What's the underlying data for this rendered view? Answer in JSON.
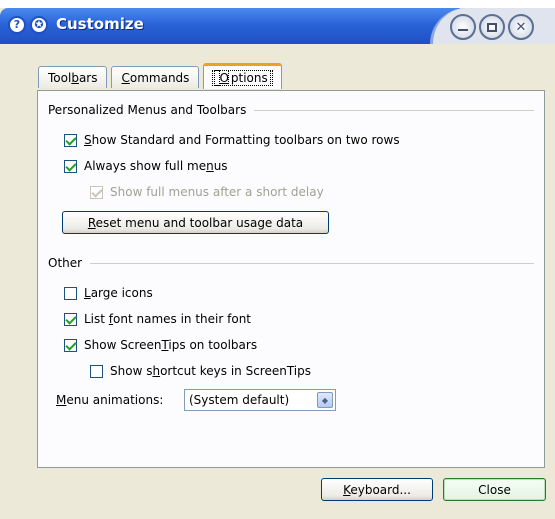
{
  "window": {
    "title": "Customize",
    "help_glyph": "?",
    "pin_glyph": "✪",
    "close_glyph": "✕"
  },
  "tabs": [
    {
      "label_pre": "Tool",
      "mnemonic": "b",
      "label_post": "ars",
      "active": false
    },
    {
      "label_pre": "",
      "mnemonic": "C",
      "label_post": "ommands",
      "active": false
    },
    {
      "label_pre": "",
      "mnemonic": "O",
      "label_post": "ptions",
      "active": true
    }
  ],
  "personalized": {
    "heading": "Personalized Menus and Toolbars",
    "options": [
      {
        "pre": "",
        "m": "S",
        "post": "how Standard and Formatting toolbars on two rows",
        "checked": true,
        "enabled": true
      },
      {
        "pre": "Always show full me",
        "m": "n",
        "post": "us",
        "checked": true,
        "enabled": true
      },
      {
        "pre": "Show full menus after a short delay",
        "m": "",
        "post": "",
        "checked": true,
        "enabled": false
      }
    ],
    "reset_button": {
      "pre": "",
      "m": "R",
      "post": "eset menu and toolbar usage data"
    }
  },
  "other": {
    "heading": "Other",
    "options": [
      {
        "pre": "",
        "m": "L",
        "post": "arge icons",
        "checked": false
      },
      {
        "pre": "List ",
        "m": "f",
        "post": "ont names in their font",
        "checked": true
      },
      {
        "pre": "Show Screen",
        "m": "T",
        "post": "ips on toolbars",
        "checked": true
      },
      {
        "pre": "Show s",
        "m": "h",
        "post": "ortcut keys in ScreenTips",
        "checked": false
      }
    ],
    "menu_animations": {
      "pre": "",
      "m": "M",
      "post": "enu animations:",
      "value": "(System default)"
    }
  },
  "footer": {
    "keyboard_button": {
      "pre": "",
      "m": "K",
      "post": "eyboard..."
    },
    "close_button": "Close"
  }
}
